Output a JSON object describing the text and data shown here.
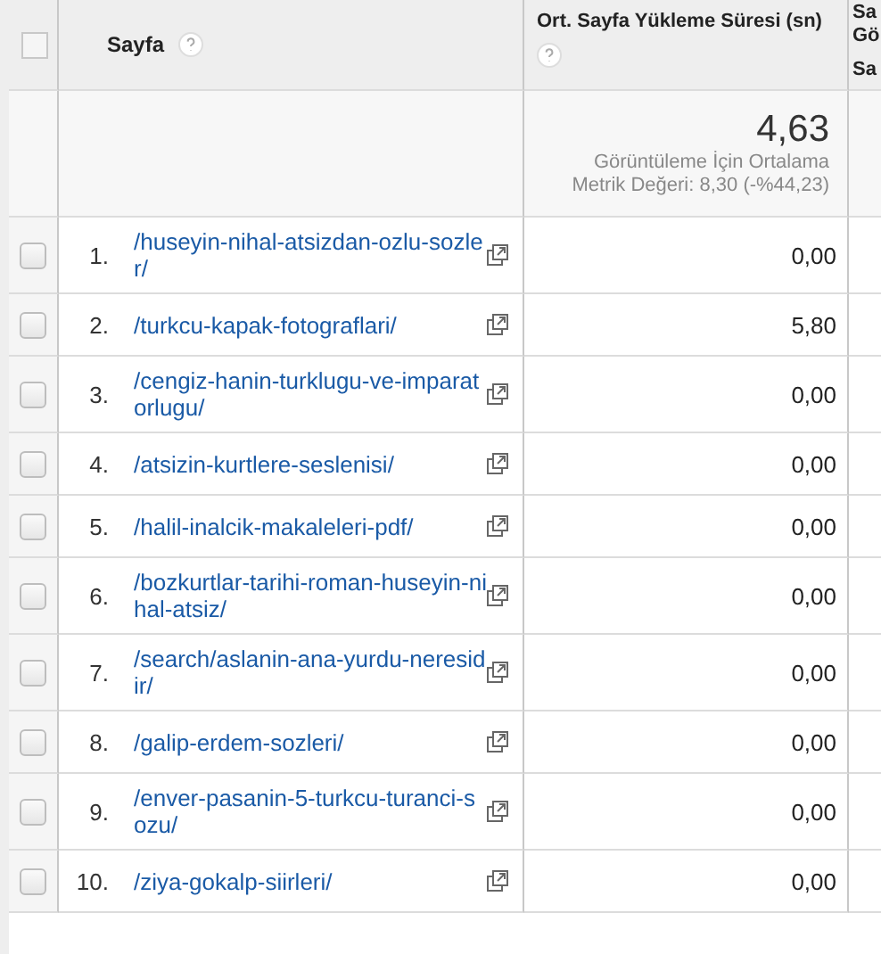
{
  "header": {
    "page_column": "Sayfa",
    "metric_column": "Ort. Sayfa Yükleme Süresi (sn)",
    "column_3": [
      "Sa",
      "Gö",
      "Sa"
    ],
    "select_all_checked": false
  },
  "summary": {
    "value": "4,63",
    "caption": "Görüntüleme İçin Ortalama",
    "comparison": "Metrik Değeri: 8,30 (-%44,23)"
  },
  "rows": [
    {
      "index": "1.",
      "page": "/huseyin-nihal-atsizdan-ozlu-sozler/",
      "value": "0,00",
      "checked": false
    },
    {
      "index": "2.",
      "page": "/turkcu-kapak-fotograflari/",
      "value": "5,80",
      "checked": false
    },
    {
      "index": "3.",
      "page": "/cengiz-hanin-turklugu-ve-imparatorlugu/",
      "value": "0,00",
      "checked": false
    },
    {
      "index": "4.",
      "page": "/atsizin-kurtlere-seslenisi/",
      "value": "0,00",
      "checked": false
    },
    {
      "index": "5.",
      "page": "/halil-inalcik-makaleleri-pdf/",
      "value": "0,00",
      "checked": false
    },
    {
      "index": "6.",
      "page": "/bozkurtlar-tarihi-roman-huseyin-nihal-atsiz/",
      "value": "0,00",
      "checked": false
    },
    {
      "index": "7.",
      "page": "/search/aslanin-ana-yurdu-neresidir/",
      "value": "0,00",
      "checked": false
    },
    {
      "index": "8.",
      "page": "/galip-erdem-sozleri/",
      "value": "0,00",
      "checked": false
    },
    {
      "index": "9.",
      "page": "/enver-pasanin-5-turkcu-turanci-sozu/",
      "value": "0,00",
      "checked": false
    },
    {
      "index": "10.",
      "page": "/ziya-gokalp-siirleri/",
      "value": "0,00",
      "checked": false
    }
  ]
}
